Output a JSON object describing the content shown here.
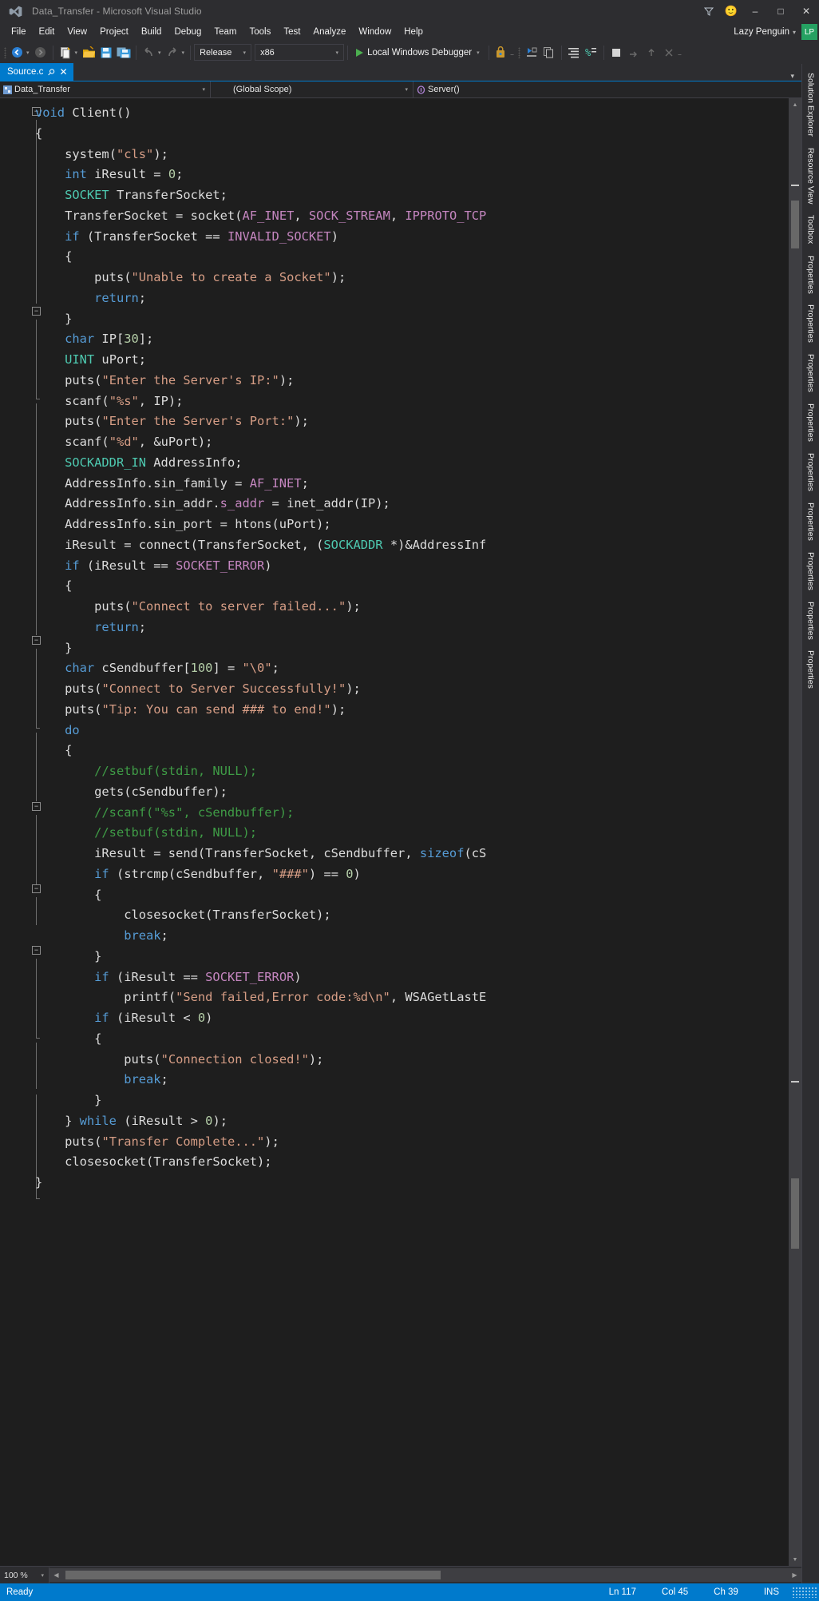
{
  "window": {
    "title": "Data_Transfer - Microsoft Visual Studio",
    "logo_icon": "visual-studio-logo-icon",
    "feedback_icon": "feedback-smiley-icon",
    "filter_icon": "quick-launch-funnel-icon",
    "minimize_label": "–",
    "maximize_label": "□",
    "close_label": "✕"
  },
  "menubar": {
    "items": [
      "File",
      "Edit",
      "View",
      "Project",
      "Build",
      "Debug",
      "Team",
      "Tools",
      "Test",
      "Analyze",
      "Window",
      "Help"
    ],
    "account_name": "Lazy Penguin",
    "account_caret": "▾",
    "avatar_initials": "LP"
  },
  "toolbar": {
    "nav_back_icon": "navigate-back-icon",
    "nav_forward_icon": "navigate-forward-icon",
    "new_project_icon": "new-project-icon",
    "open_file_icon": "open-file-icon",
    "save_icon": "save-icon",
    "save_all_icon": "save-all-icon",
    "undo_icon": "undo-icon",
    "redo_icon": "redo-icon",
    "config_value": "Release",
    "platform_value": "x86",
    "run_label": "Local Windows Debugger",
    "run_icon": "play-triangle-icon",
    "caret": "▾"
  },
  "tabs": {
    "active": {
      "label": "Source.c",
      "pin_icon": "pin-icon",
      "close_icon": "close-icon"
    },
    "overflow_icon": "chevron-down-icon"
  },
  "navbar": {
    "project": "Data_Transfer",
    "project_icon": "project-icon",
    "scope": "(Global Scope)",
    "member": "Server()",
    "member_icon": "method-icon",
    "caret": "▾"
  },
  "dockstrip": {
    "items": [
      "Solution Explorer",
      "Resource View",
      "Toolbox",
      "Properties",
      "Properties",
      "Properties",
      "Properties",
      "Properties",
      "Properties",
      "Properties",
      "Properties",
      "Properties"
    ]
  },
  "editor": {
    "zoom_level": "100 %",
    "zoom_caret": "▾",
    "scroll_up_icon": "scroll-up-arrow-icon",
    "scroll_down_icon": "scroll-down-arrow-icon",
    "scroll_left_icon": "scroll-left-arrow-icon",
    "scroll_right_icon": "scroll-right-arrow-icon",
    "code_lines": [
      "void Client()",
      "{",
      "    system(\"cls\");",
      "    int iResult = 0;",
      "    SOCKET TransferSocket;",
      "    TransferSocket = socket(AF_INET, SOCK_STREAM, IPPROTO_TCP",
      "    if (TransferSocket == INVALID_SOCKET)",
      "    {",
      "        puts(\"Unable to create a Socket\");",
      "        return;",
      "    }",
      "    char IP[30];",
      "    UINT uPort;",
      "    puts(\"Enter the Server's IP:\");",
      "    scanf(\"%s\", IP);",
      "    puts(\"Enter the Server's Port:\");",
      "    scanf(\"%d\", &uPort);",
      "    SOCKADDR_IN AddressInfo;",
      "    AddressInfo.sin_family = AF_INET;",
      "    AddressInfo.sin_addr.s_addr = inet_addr(IP);",
      "    AddressInfo.sin_port = htons(uPort);",
      "    iResult = connect(TransferSocket, (SOCKADDR *)&AddressInf",
      "    if (iResult == SOCKET_ERROR)",
      "    {",
      "        puts(\"Connect to server failed...\");",
      "        return;",
      "    }",
      "    char cSendbuffer[100] = \"\\0\";",
      "    puts(\"Connect to Server Successfully!\");",
      "    puts(\"Tip: You can send ### to end!\");",
      "    do",
      "    {",
      "        //setbuf(stdin, NULL);",
      "        gets(cSendbuffer);",
      "        //scanf(\"%s\", cSendbuffer);",
      "        //setbuf(stdin, NULL);",
      "        iResult = send(TransferSocket, cSendbuffer, sizeof(cS",
      "        if (strcmp(cSendbuffer, \"###\") == 0)",
      "        {",
      "            closesocket(TransferSocket);",
      "            break;",
      "        }",
      "        if (iResult == SOCKET_ERROR)",
      "            printf(\"Send failed,Error code:%d\\n\", WSAGetLastE",
      "        if (iResult < 0)",
      "        {",
      "            puts(\"Connection closed!\");",
      "            break;",
      "        }",
      "    } while (iResult > 0);",
      "    puts(\"Transfer Complete...\");",
      "    closesocket(TransferSocket);",
      "}"
    ]
  },
  "statusbar": {
    "message": "Ready",
    "line": "Ln 117",
    "column": "Col 45",
    "character": "Ch 39",
    "insert_mode": "INS"
  },
  "colors": {
    "accent": "#007acc",
    "chrome": "#2d2d30",
    "editor_bg": "#1e1e1e",
    "keyword": "#569cd6",
    "type": "#4ec9b0",
    "macro": "#c586c0",
    "string": "#d69d85",
    "number": "#b5cea8",
    "comment": "#3f9c46",
    "avatar_green": "#25a162"
  }
}
